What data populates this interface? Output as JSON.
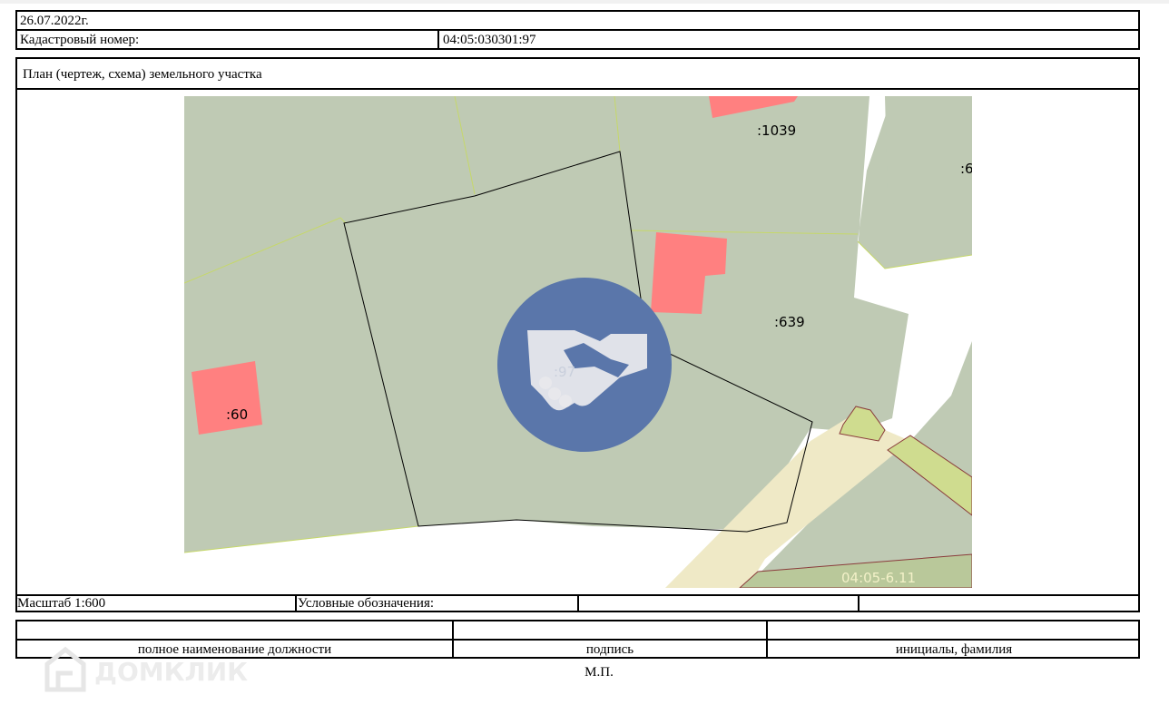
{
  "header": {
    "date": "26.07.2022г.",
    "cadastral_label": "Кадастровый номер:",
    "cadastral_value": "04:05:030301:97"
  },
  "plan": {
    "title": "План (чертеж, схема) земельного участка",
    "map_labels": {
      "parcel_1039": ":1039",
      "parcel_6": ":6",
      "parcel_639": ":639",
      "parcel_97": ":97",
      "parcel_60": ":60",
      "zone": "04:05-6.11"
    },
    "colors": {
      "parcel_fill": "#bfcab4",
      "building_fill": "#ff8080",
      "zone_fill": "#cfdc8f",
      "road_fill": "#efe9c6",
      "watermark_circle": "#5a76aa"
    },
    "watermark_icon": "handshake-icon"
  },
  "footer_row": {
    "scale": "Масштаб 1:600",
    "legend_label": "Условные обозначения:"
  },
  "signature": {
    "position_caption": "полное наименование должности",
    "signature_caption": "подпись",
    "name_caption": "инициалы, фамилия",
    "seal": "М.П."
  },
  "brand_watermark": {
    "text": "ДОМКЛИК",
    "icon": "house-logo-icon"
  }
}
